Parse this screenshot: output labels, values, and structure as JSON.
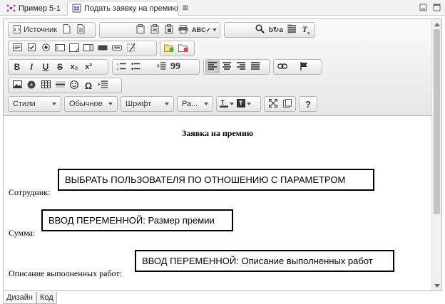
{
  "tabs": [
    {
      "label": "Пример 5-1"
    },
    {
      "label": "Подать заявку на премию"
    }
  ],
  "toolbar": {
    "source_label": "Источник",
    "bold_label": "B",
    "italic_label": "I",
    "underline_label": "U",
    "strike_label": "S",
    "subscript_label": "x₂",
    "superscript_label": "x²",
    "quote_label": "99",
    "omega_label": "Ω",
    "help_label": "?",
    "styles_combo": "Стили",
    "format_combo": "Обычное",
    "font_combo": "Шрифт",
    "size_combo": "Ра..."
  },
  "document": {
    "heading": "Заявка на премию",
    "rows": [
      {
        "label": "Сотрудник:",
        "field": "ВЫБРАТЬ ПОЛЬЗОВАТЕЛЯ ПО ОТНОШЕНИЮ С ПАРАМЕТРОМ"
      },
      {
        "label": "Сумма:",
        "field": "ВВОД ПЕРЕМЕННОЙ: Размер премии"
      },
      {
        "label": "Описание выполненных работ:",
        "field": "ВВОД ПЕРЕМЕННОЙ: Описание выполненных работ"
      }
    ]
  },
  "bottom_tabs": [
    {
      "label": "Дизайн"
    },
    {
      "label": "Код"
    }
  ],
  "colors": {
    "accent": "#5c6bc0",
    "toolbar_bg": "#e6e6e6",
    "active_button": "#c8c8c8"
  }
}
